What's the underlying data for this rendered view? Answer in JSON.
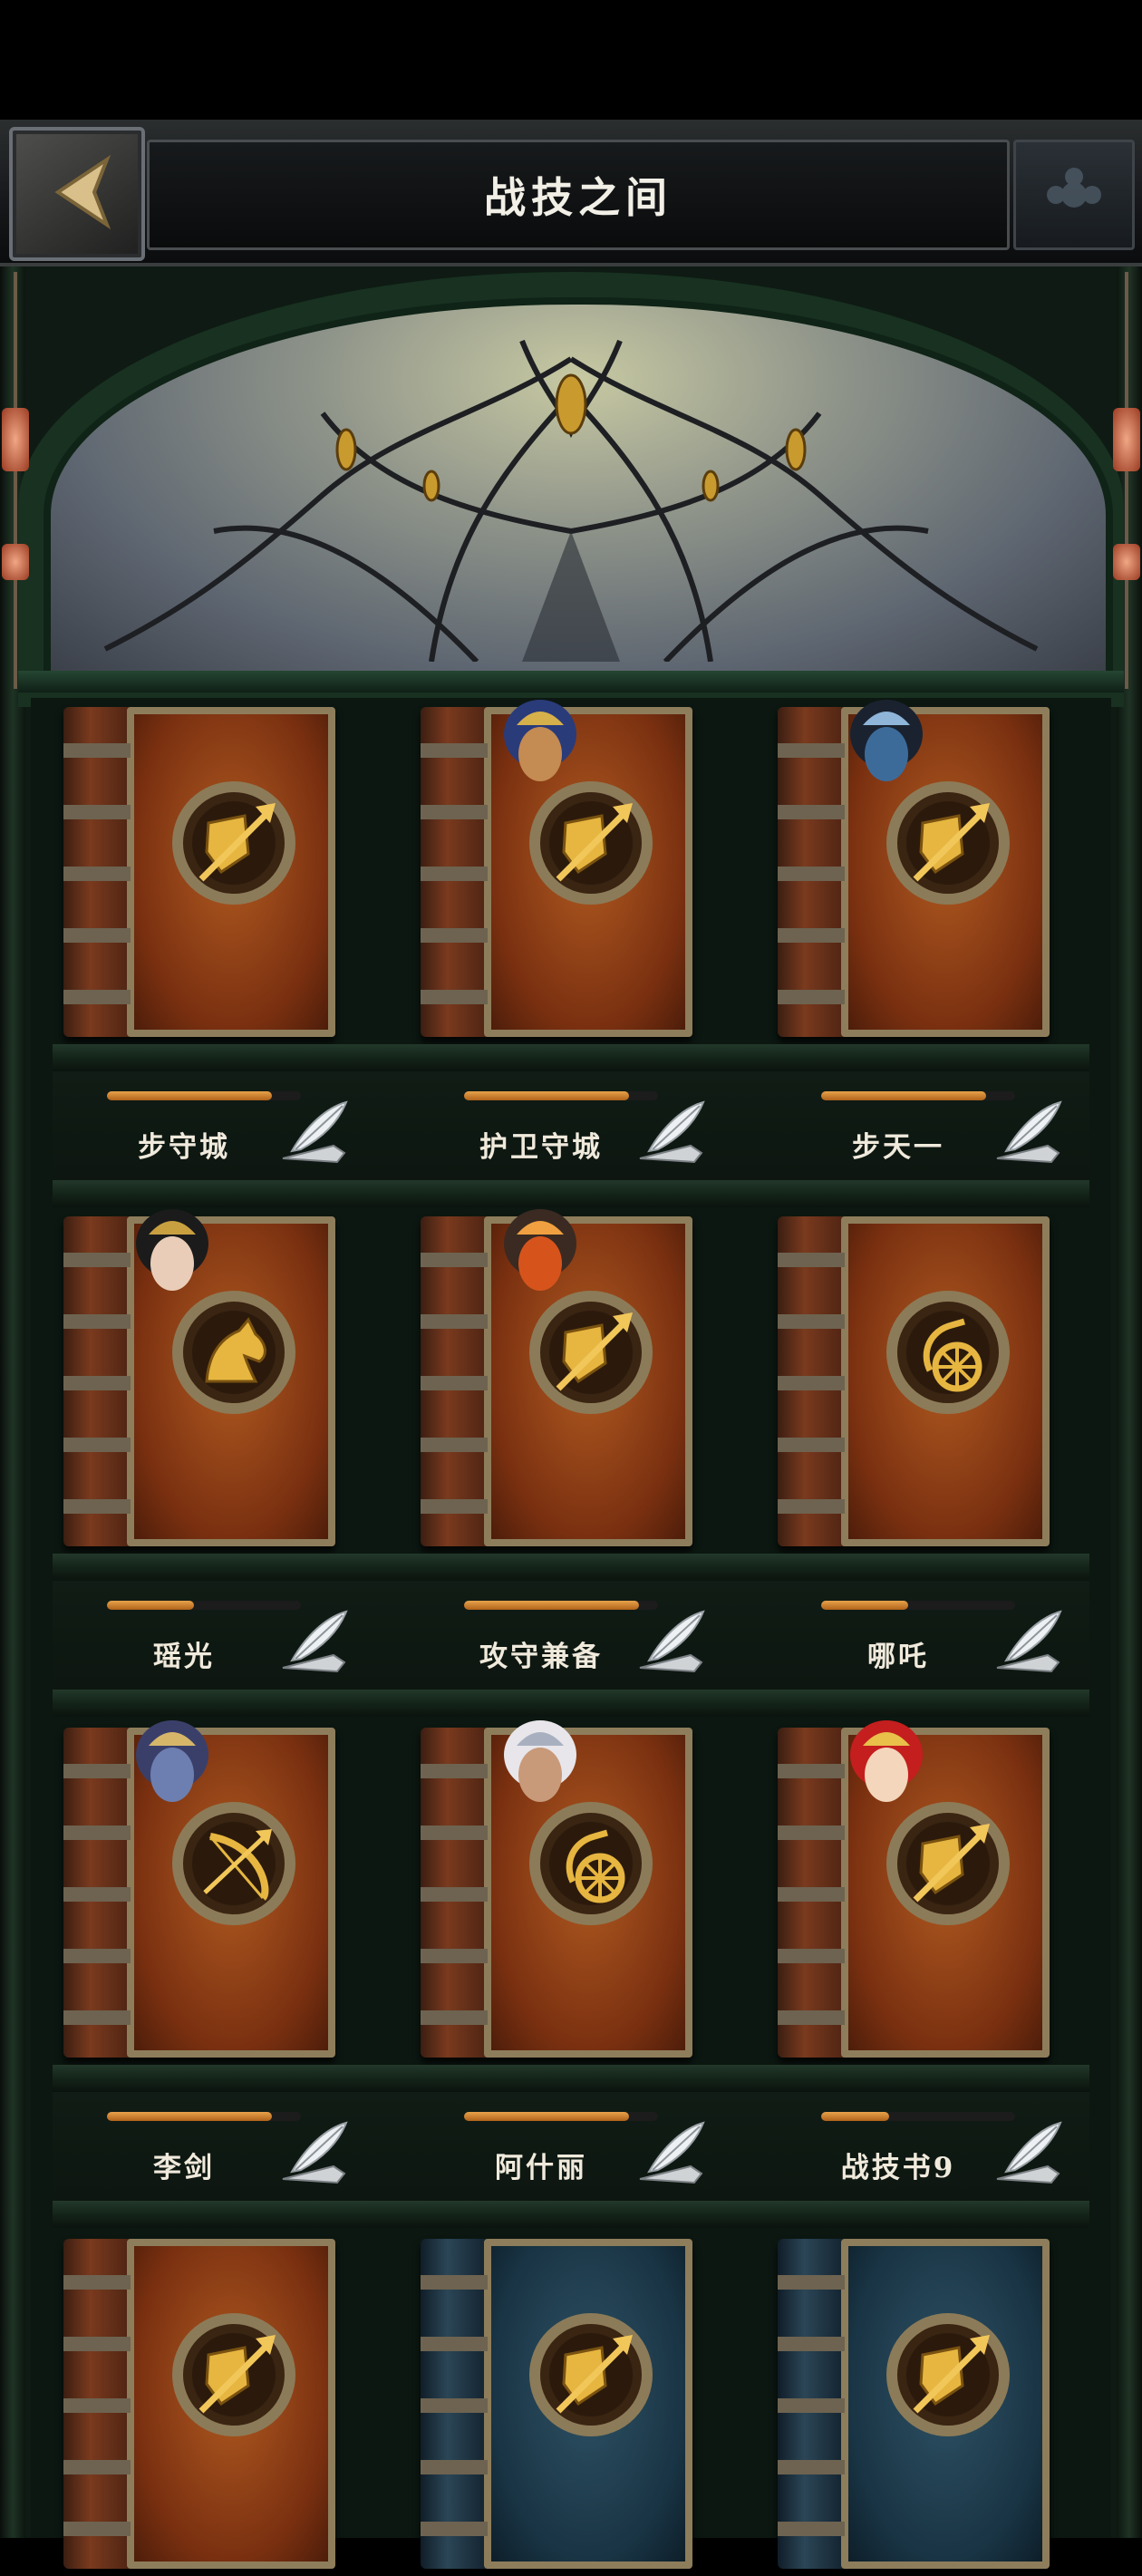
{
  "header": {
    "title": "战技之间"
  },
  "books": [
    {
      "name": "步守城",
      "progress": 0.85,
      "color": "brown",
      "emblem": "spear-shield-emblem",
      "avatar": null
    },
    {
      "name": "护卫守城",
      "progress": 0.85,
      "color": "brown",
      "emblem": "spear-shield-emblem",
      "avatar": "pharaoh-hero-avatar"
    },
    {
      "name": "步天一",
      "progress": 0.85,
      "color": "brown",
      "emblem": "spear-shield-emblem",
      "avatar": "armored-knight-avatar"
    },
    {
      "name": "瑶光",
      "progress": 0.45,
      "color": "brown",
      "emblem": "horse-emblem",
      "avatar": "empress-hero-avatar"
    },
    {
      "name": "攻守兼备",
      "progress": 0.9,
      "color": "brown",
      "emblem": "spear-shield-emblem",
      "avatar": "flame-book-avatar"
    },
    {
      "name": "哪吒",
      "progress": 0.45,
      "color": "brown",
      "emblem": "chariot-emblem",
      "avatar": null
    },
    {
      "name": "李剑",
      "progress": 0.85,
      "color": "brown",
      "emblem": "bow-emblem",
      "avatar": "dark-elf-avatar"
    },
    {
      "name": "阿什丽",
      "progress": 0.85,
      "color": "brown",
      "emblem": "chariot-emblem",
      "avatar": "white-hair-warrior-avatar"
    },
    {
      "name": "战技书9",
      "progress": 0.35,
      "color": "brown",
      "emblem": "spear-shield-emblem",
      "avatar": "santa-hat-heroine-avatar"
    },
    {
      "name": "",
      "progress": 0,
      "color": "brown",
      "emblem": "spear-shield-emblem",
      "avatar": null
    },
    {
      "name": "",
      "progress": 0,
      "color": "blue",
      "emblem": "spear-shield-emblem",
      "avatar": null
    },
    {
      "name": "",
      "progress": 0,
      "color": "blue",
      "emblem": "spear-shield-emblem",
      "avatar": null
    }
  ],
  "icons": {
    "back": "left-arrow-icon",
    "settings": "ornament-icon",
    "edit": "quill-icon"
  },
  "colors": {
    "progress": "#d4862e",
    "cover_brown": "#9a4a18",
    "cover_blue": "#2a4a5c",
    "frame_green": "#183120"
  }
}
